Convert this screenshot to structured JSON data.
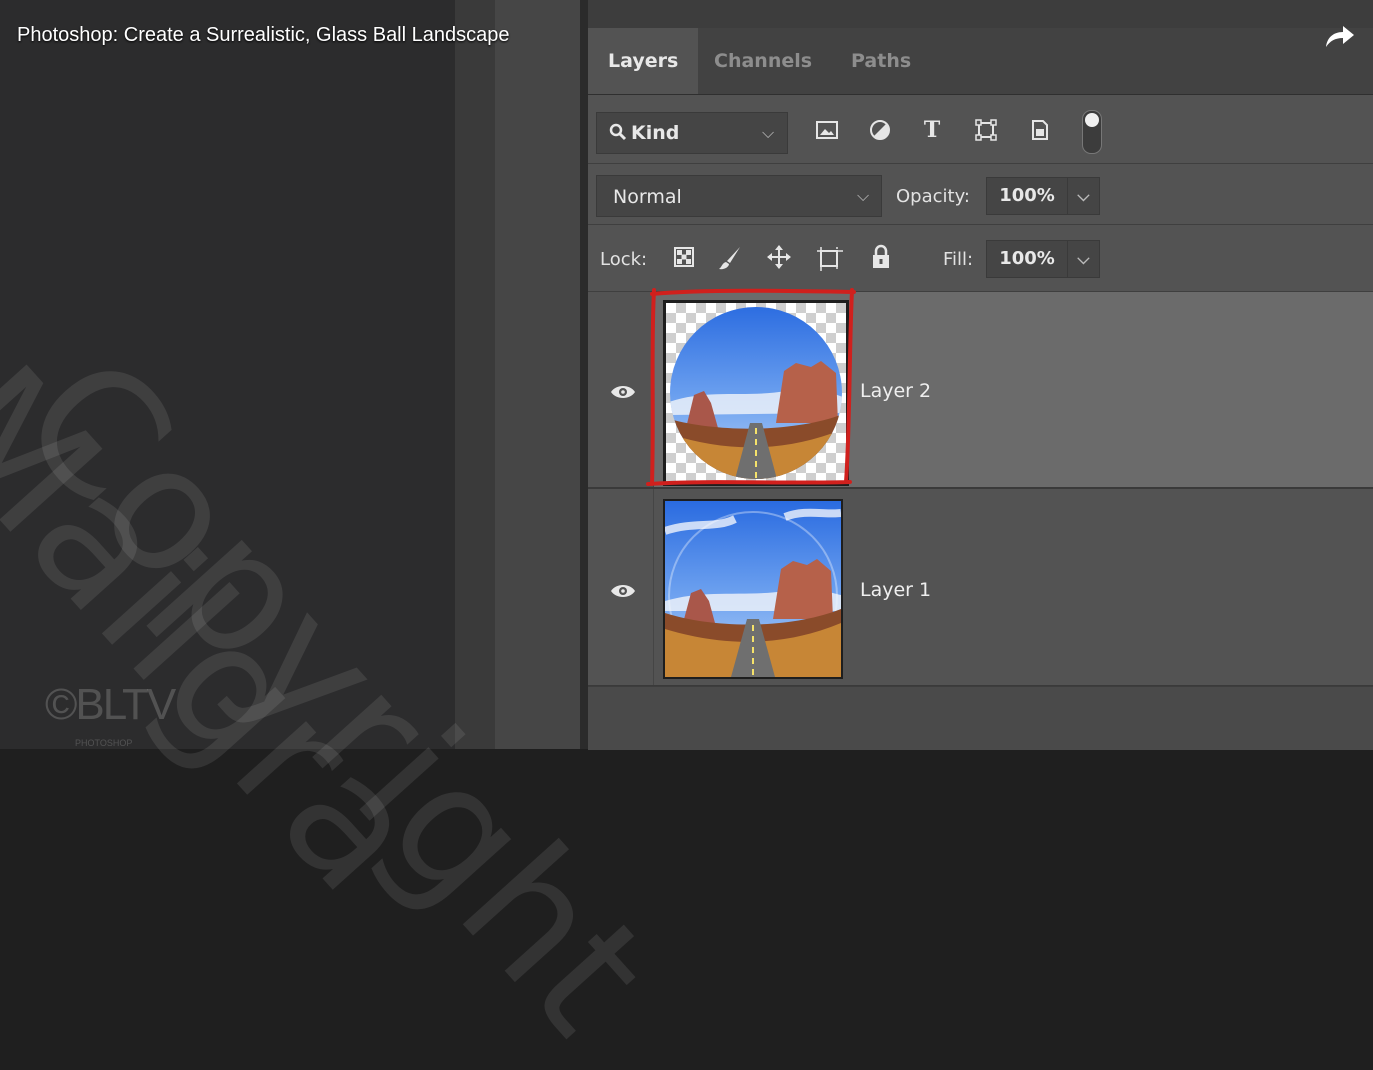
{
  "video": {
    "title": "Photoshop: Create a Surrealistic, Glass Ball Landscape",
    "share_icon": "share-arrow-icon"
  },
  "watermark": {
    "line1": "Copyright",
    "line2": "Mailgra",
    "logo": "©BLTV",
    "logo_sub": "PHOTOSHOP"
  },
  "tabs": [
    {
      "label": "Layers",
      "active": true
    },
    {
      "label": "Channels",
      "active": false
    },
    {
      "label": "Paths",
      "active": false
    }
  ],
  "filter": {
    "kind_label": "Kind",
    "icons": [
      "image-filter-icon",
      "adjustment-filter-icon",
      "type-filter-icon",
      "shape-filter-icon",
      "smart-object-filter-icon",
      "filter-toggle-icon"
    ]
  },
  "blend": {
    "mode": "Normal",
    "opacity_label": "Opacity:",
    "opacity_value": "100%"
  },
  "lock": {
    "label": "Lock:",
    "icons": [
      "lock-transparent-pixels-icon",
      "lock-image-pixels-icon",
      "lock-position-icon",
      "lock-artboard-icon",
      "lock-all-icon"
    ],
    "fill_label": "Fill:",
    "fill_value": "100%"
  },
  "layers": [
    {
      "name": "Layer 2",
      "selected": true,
      "visible": true
    },
    {
      "name": "Layer 1",
      "selected": false,
      "visible": true
    }
  ],
  "colors": {
    "highlight": "#d0201d",
    "panel": "#535353"
  }
}
